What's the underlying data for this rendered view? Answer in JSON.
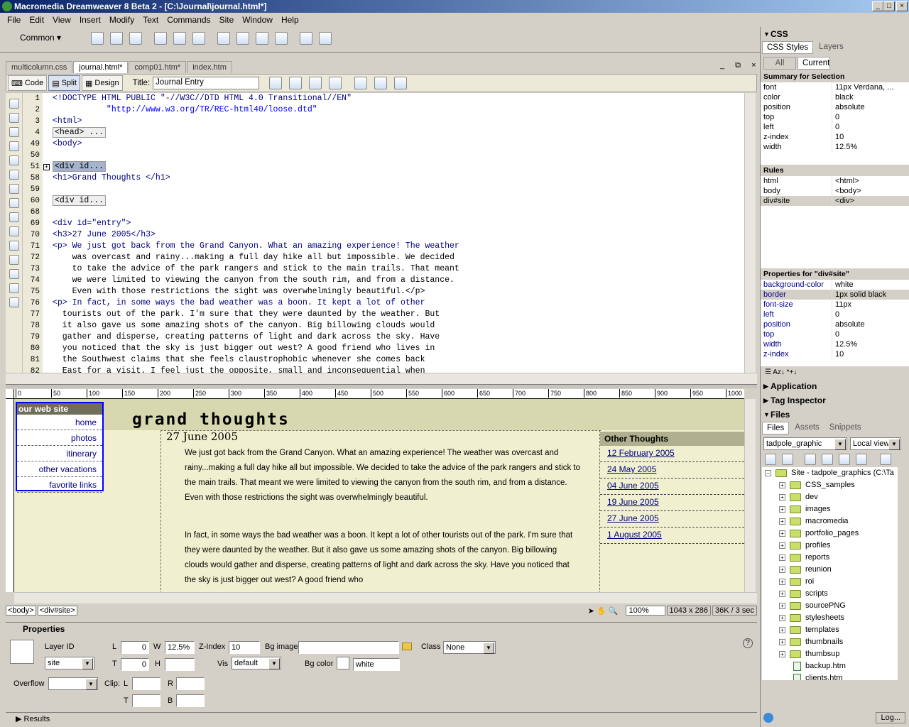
{
  "app": {
    "title": "Macromedia Dreamweaver 8 Beta 2 - [C:\\Journal\\journal.html*]"
  },
  "menu": [
    "File",
    "Edit",
    "View",
    "Insert",
    "Modify",
    "Text",
    "Commands",
    "Site",
    "Window",
    "Help"
  ],
  "insert_bar": {
    "category": "Common"
  },
  "doc_tabs": [
    "multicolumn.css",
    "journal.html*",
    "comp01.htm*",
    "index.htm"
  ],
  "doc_toolbar": {
    "code": "Code",
    "split": "Split",
    "design": "Design",
    "title_label": "Title:",
    "title_value": "Journal Entry"
  },
  "code": {
    "line_numbers": [
      "1",
      "2",
      "3",
      "4",
      "49",
      "50",
      "51",
      "58",
      "59",
      "60",
      "68",
      "69",
      "70",
      "71",
      "72",
      "73",
      "74",
      "75",
      "76",
      "77",
      "78",
      "79",
      "80",
      "81",
      "82"
    ],
    "lines": [
      "<!DOCTYPE HTML PUBLIC \"-//W3C//DTD HTML 4.0 Transitional//EN\"",
      "           \"http://www.w3.org/TR/REC-html40/loose.dtd\"",
      "<html>",
      "<head> ...",
      "<body>",
      "",
      "<div id...",
      "<h1>Grand Thoughts </h1>",
      "",
      "<div id...",
      "",
      "<div id=\"entry\">",
      "<h3>27 June 2005</h3>",
      "<p> We just got back from the Grand Canyon. What an amazing experience! The weather",
      "    was overcast and rainy...making a full day hike all but impossible. We decided",
      "    to take the advice of the park rangers and stick to the main trails. That meant",
      "    we were limited to viewing the canyon from the south rim, and from a distance.",
      "    Even with those restrictions the sight was overwhelmingly beautiful.</p>",
      "<p> In fact, in some ways the bad weather was a boon. It kept a lot of other",
      "  tourists out of the park. I'm sure that they were daunted by the weather. But",
      "  it also gave us some amazing shots of the canyon. Big billowing clouds would",
      "  gather and disperse, creating patterns of light and dark across the sky. Have",
      "  you noticed that the sky is just bigger out west? A good friend who lives in",
      "  the Southwest claims that she feels claustrophobic whenever she comes back",
      "  East for a visit. I feel just the opposite, small and inconsequential when"
    ]
  },
  "ruler": [
    "0",
    "50",
    "100",
    "150",
    "200",
    "250",
    "300",
    "350",
    "400",
    "450",
    "500",
    "550",
    "600",
    "650",
    "700",
    "750",
    "800",
    "850",
    "900",
    "950",
    "1000"
  ],
  "design": {
    "nav_title": "our web site",
    "nav": [
      "home",
      "photos",
      "itinerary",
      "other vacations",
      "favorite links"
    ],
    "heading": "grand thoughts",
    "entry_date": "27 June 2005",
    "para1": "We just got back from the Grand Canyon. What an amazing experience! The weather was overcast and rainy...making a full day hike all but impossible. We decided to take the advice of the park rangers and stick to the main trails. That meant we were limited to viewing the canyon from the south rim, and from a distance. Even with those restrictions the sight was overwhelmingly beautiful.",
    "para2": "In fact, in some ways the bad weather was a boon. It kept a lot of other tourists out of the park. I'm sure that they were daunted by the weather. But it also gave us some amazing shots of the canyon. Big billowing clouds would gather and disperse, creating patterns of light and dark across the sky. Have you noticed that the sky is just bigger out west? A good friend who",
    "other_title": "Other Thoughts",
    "other": [
      "12 February 2005",
      "24 May 2005",
      "04 June 2005",
      "19 June 2005",
      "27 June 2005",
      "1 August 2005"
    ]
  },
  "status": {
    "tag1": "<body>",
    "tag2": "<div#site>",
    "zoom": "100%",
    "size": "1043 x 286",
    "weight": "36K / 3 sec"
  },
  "properties": {
    "title": "Properties",
    "layer_id_label": "Layer ID",
    "layer_id": "site",
    "L": "L",
    "L_val": "0",
    "W": "W",
    "W_val": "12.5%",
    "zindex_label": "Z-Index",
    "zindex": "10",
    "bgimage_label": "Bg image",
    "class_label": "Class",
    "class_val": "None",
    "T": "T",
    "T_val": "0",
    "H": "H",
    "vis_label": "Vis",
    "vis_val": "default",
    "bgcolor_label": "Bg color",
    "bgcolor_val": "white",
    "overflow_label": "Overflow",
    "clip_label": "Clip:",
    "clip_L": "L",
    "clip_R": "R",
    "clip_T": "T",
    "clip_B": "B"
  },
  "results": "Results",
  "css_panel": {
    "title": "CSS",
    "tabs": [
      "CSS Styles",
      "Layers"
    ],
    "mode": [
      "All",
      "Current"
    ],
    "summary_title": "Summary for Selection",
    "summary": [
      [
        "font",
        "11px Verdana, ..."
      ],
      [
        "color",
        "black"
      ],
      [
        "position",
        "absolute"
      ],
      [
        "top",
        "0"
      ],
      [
        "left",
        "0"
      ],
      [
        "z-index",
        "10"
      ],
      [
        "width",
        "12.5%"
      ]
    ],
    "rules_title": "Rules",
    "rules": [
      [
        "html",
        "<html>"
      ],
      [
        "body",
        "<body>"
      ],
      [
        "div#site",
        "<div>"
      ]
    ],
    "props_title": "Properties for \"div#site\"",
    "props": [
      [
        "background-color",
        "white"
      ],
      [
        "border",
        "1px solid black"
      ],
      [
        "font-size",
        "11px"
      ],
      [
        "left",
        "0"
      ],
      [
        "position",
        "absolute"
      ],
      [
        "top",
        "0"
      ],
      [
        "width",
        "12.5%"
      ],
      [
        "z-index",
        "10"
      ]
    ]
  },
  "application": "Application",
  "tag_inspector": "Tag Inspector",
  "files": {
    "title": "Files",
    "tabs": [
      "Files",
      "Assets",
      "Snippets"
    ],
    "site": "tadpole_graphic",
    "view": "Local view",
    "root": "Site - tadpole_graphics (C:\\Ta",
    "folders": [
      "CSS_samples",
      "dev",
      "images",
      "macromedia",
      "portfolio_pages",
      "profiles",
      "reports",
      "reunion",
      "roi",
      "scripts",
      "sourcePNG",
      "stylesheets",
      "templates",
      "thumbnails",
      "thumbsup"
    ],
    "files": [
      "backup.htm",
      "clients.htm"
    ],
    "log": "Log..."
  },
  "colors": {
    "title_start": "#0a246a",
    "design_bg": "#f0f0d0",
    "link": "#000080"
  }
}
